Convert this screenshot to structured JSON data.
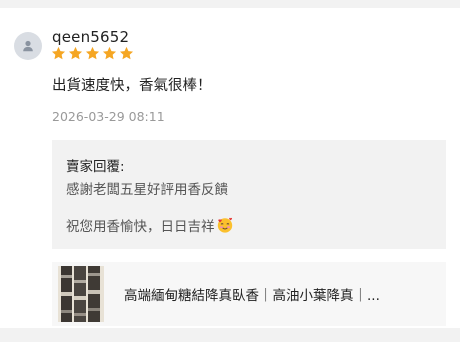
{
  "review": {
    "username": "qeen5652",
    "rating": 5,
    "rating_max": 5,
    "comment": "出貨速度快，香氣很棒！",
    "timestamp": "2026-03-29 08:11",
    "star_color": "#f5a623"
  },
  "seller_reply": {
    "title": "賣家回覆:",
    "line1": "感謝老闆五星好評用香反饋",
    "line2": "祝您用香愉快，日日吉祥"
  },
  "product": {
    "name": "高端緬甸糖結降真臥香｜高油小葉降真｜..."
  },
  "icons": {
    "avatar": "user-icon",
    "star": "star-icon",
    "emoji": "smiling-face-with-hearts-icon",
    "thumbnail": "product-thumbnail"
  }
}
